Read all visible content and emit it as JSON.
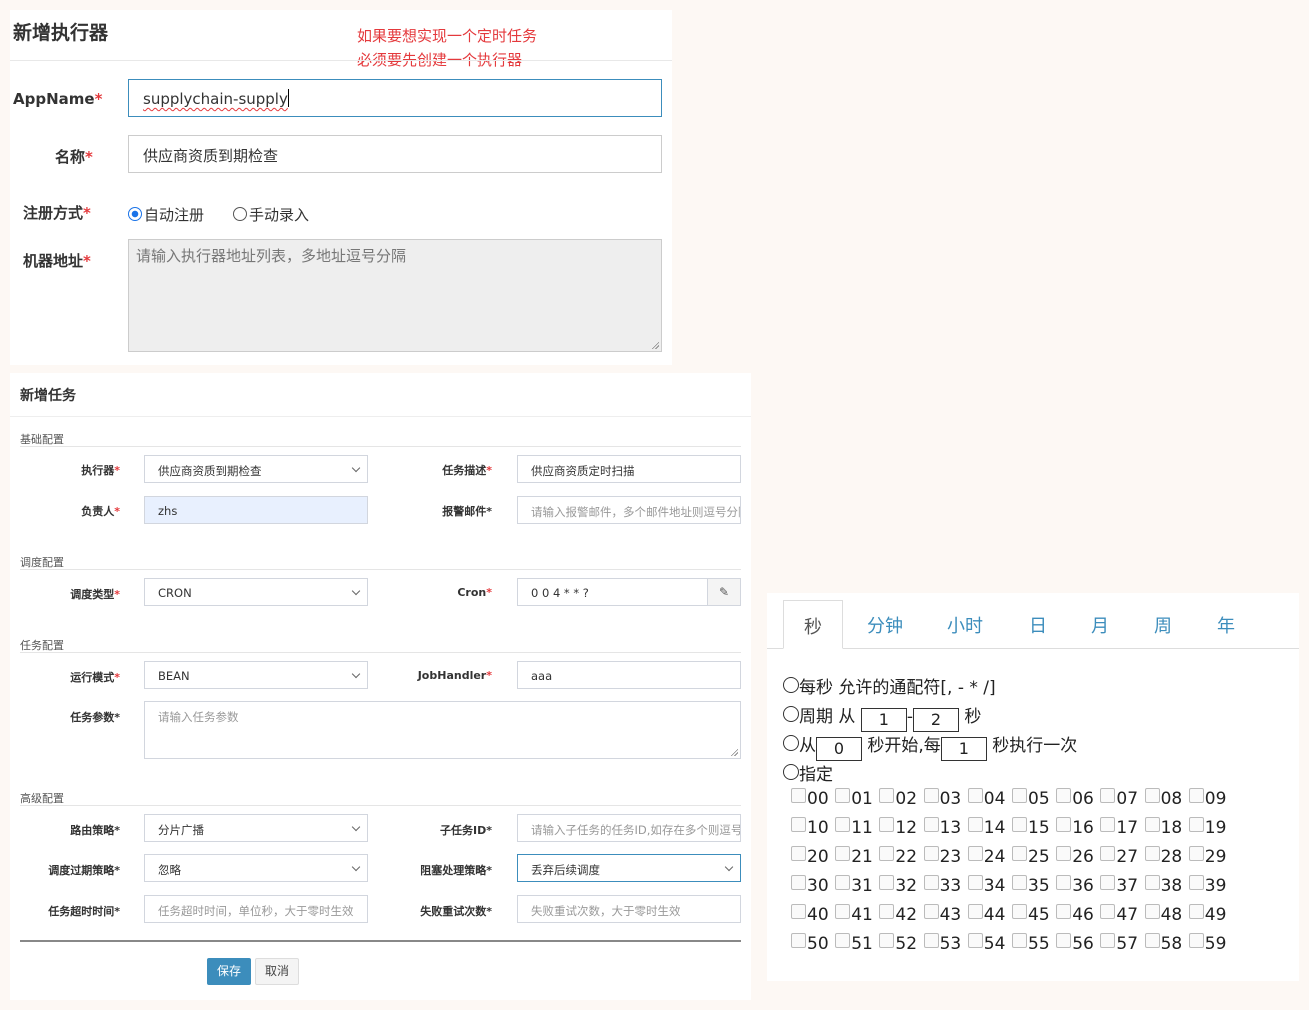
{
  "executor_form": {
    "title": "新增执行器",
    "note_lines": [
      "如果要想实现一个定时任务",
      "必须要先创建一个执行器"
    ],
    "required_mark": "*",
    "appname_label": "AppName",
    "appname_value": "supplychain-supply",
    "name_label": "名称",
    "name_value": "供应商资质到期检查",
    "register_label": "注册方式",
    "register_options": [
      "自动注册",
      "手动录入"
    ],
    "register_selected": "自动注册",
    "address_label": "机器地址",
    "address_placeholder": "请输入执行器地址列表，多地址逗号分隔"
  },
  "task_form": {
    "title": "新增任务",
    "required_mark": "*",
    "sections": {
      "basic": "基础配置",
      "schedule": "调度配置",
      "task": "任务配置",
      "advanced": "高级配置"
    },
    "executor": {
      "label": "执行器",
      "value": "供应商资质到期检查"
    },
    "desc": {
      "label": "任务描述",
      "value": "供应商资质定时扫描"
    },
    "owner": {
      "label": "负责人",
      "value": "zhs"
    },
    "alarm_email": {
      "label": "报警邮件",
      "placeholder": "请输入报警邮件，多个邮件地址则逗号分隔"
    },
    "schedule_type": {
      "label": "调度类型",
      "value": "CRON"
    },
    "cron": {
      "label": "Cron",
      "value": "0 0 4 * * ?"
    },
    "run_mode": {
      "label": "运行模式",
      "value": "BEAN"
    },
    "job_handler": {
      "label": "JobHandler",
      "value": "aaa"
    },
    "task_param": {
      "label": "任务参数",
      "placeholder": "请输入任务参数"
    },
    "route": {
      "label": "路由策略",
      "value": "分片广播"
    },
    "child_id": {
      "label": "子任务ID",
      "placeholder": "请输入子任务的任务ID,如存在多个则逗号分隔"
    },
    "misfire": {
      "label": "调度过期策略",
      "value": "忽略"
    },
    "block": {
      "label": "阻塞处理策略",
      "value": "丢弃后续调度"
    },
    "timeout": {
      "label": "任务超时时间",
      "placeholder": "任务超时时间，单位秒，大于零时生效"
    },
    "retry": {
      "label": "失败重试次数",
      "placeholder": "失败重试次数，大于零时生效"
    },
    "save_label": "保存",
    "cancel_label": "取消"
  },
  "cron_editor": {
    "tabs": [
      "秒",
      "分钟",
      "小时",
      "日",
      "月",
      "周",
      "年"
    ],
    "active_tab": "秒",
    "every": "每秒 允许的通配符[, - * /]",
    "period": {
      "prefix": "周期 从",
      "from": "1",
      "dash": "-",
      "to": "2",
      "suffix": "秒"
    },
    "start": {
      "prefix": "从",
      "start": "0",
      "middle": "秒开始,每",
      "interval": "1",
      "suffix": "秒执行一次"
    },
    "specify": "指定",
    "seconds": [
      "00",
      "01",
      "02",
      "03",
      "04",
      "05",
      "06",
      "07",
      "08",
      "09",
      "10",
      "11",
      "12",
      "13",
      "14",
      "15",
      "16",
      "17",
      "18",
      "19",
      "20",
      "21",
      "22",
      "23",
      "24",
      "25",
      "26",
      "27",
      "28",
      "29",
      "30",
      "31",
      "32",
      "33",
      "34",
      "35",
      "36",
      "37",
      "38",
      "39",
      "40",
      "41",
      "42",
      "43",
      "44",
      "45",
      "46",
      "47",
      "48",
      "49",
      "50",
      "51",
      "52",
      "53",
      "54",
      "55",
      "56",
      "57",
      "58",
      "59"
    ]
  }
}
